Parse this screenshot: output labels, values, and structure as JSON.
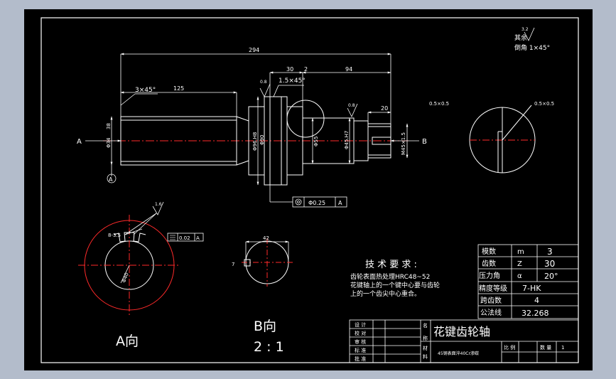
{
  "drawing": {
    "title": "花键齿轮轴",
    "view_a_label": "A向",
    "view_b_label": "B向",
    "view_b_scale": "2 : 1",
    "tech_req_title": "技 术 要 求 :",
    "tech_req_lines": [
      "齿轮表面热处理HRC48~52",
      "花键轴上的一个键中心要与齿轮",
      "上的一个齿尖中心重合。"
    ],
    "other_roughness": "其余",
    "roughness_other_value": "3.2",
    "chamfer_note": "倒角 1×45°",
    "material": "45钢表面淬40Cr渗碳",
    "params": [
      {
        "name": "模数",
        "symbol": "m",
        "value": "3"
      },
      {
        "name": "齿数",
        "symbol": "Z",
        "value": "30"
      },
      {
        "name": "压力角",
        "symbol": "α",
        "value": "20°"
      },
      {
        "name": "精度等级",
        "symbol": "",
        "value": "7-HK"
      },
      {
        "name": "跨齿数",
        "symbol": "",
        "value": "4"
      },
      {
        "name": "公法线",
        "symbol": "",
        "value": "32.268"
      }
    ],
    "title_block_labels": [
      "设 计",
      "校 对",
      "审 核",
      "标 准",
      "批 准"
    ],
    "title_block_side": [
      "名",
      "称",
      "材",
      "料"
    ],
    "scale_label": "比 例",
    "qty_label": "数 量",
    "qty_value": "1"
  },
  "dims": {
    "overall_length": "294",
    "len_125": "125",
    "chamfer_3x45": "3×45°",
    "chamfer_1_5x45": "1.5×45°",
    "len_30": "30",
    "len_2": "2",
    "len_94": "94",
    "len_20": "20",
    "dia_34": "Φ34",
    "val_38": "38",
    "dia_96": "Φ96.H8",
    "dia_90": "Φ90",
    "dia_55": "Φ55",
    "dia_45": "Φ45.H7",
    "thread": "M45×1.5",
    "detail": "0.5×0.5",
    "runout_tol": "Φ0.25",
    "runout_datum": "A",
    "sym_tol": "0.02",
    "sym_datum": "A",
    "spline_spec": "8-3.5",
    "spline_dia": "Φ40",
    "view_b_width": "42",
    "view_b_key": "7",
    "rough_08": "0.8",
    "rough_16": "1.6",
    "rough_3_2": "3.2",
    "arrow_a": "A",
    "arrow_b": "B",
    "datum_a": "A"
  }
}
